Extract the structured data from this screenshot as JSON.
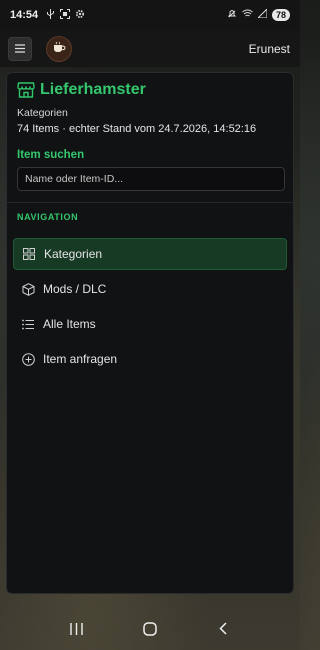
{
  "status_bar": {
    "time": "14:54",
    "battery": "78"
  },
  "app_bar": {
    "user_name": "Erunest"
  },
  "drawer": {
    "app_name": "Lieferhamster",
    "section": "Kategorien",
    "summary": "74 Items · echter Stand vom 24.7.2026, 14:52:16",
    "search": {
      "label": "Item suchen",
      "placeholder": "Name oder Item-ID...",
      "value": ""
    },
    "nav_heading": "NAVIGATION",
    "nav_items": [
      {
        "label": "Kategorien",
        "icon": "grid-icon",
        "active": true
      },
      {
        "label": "Mods / DLC",
        "icon": "box-icon",
        "active": false
      },
      {
        "label": "Alle Items",
        "icon": "list-icon",
        "active": false
      },
      {
        "label": "Item anfragen",
        "icon": "plus-circle-icon",
        "active": false
      }
    ]
  },
  "colors": {
    "accent": "#34c76d",
    "active_bg": "#173a25",
    "drawer_bg": "#111214"
  }
}
